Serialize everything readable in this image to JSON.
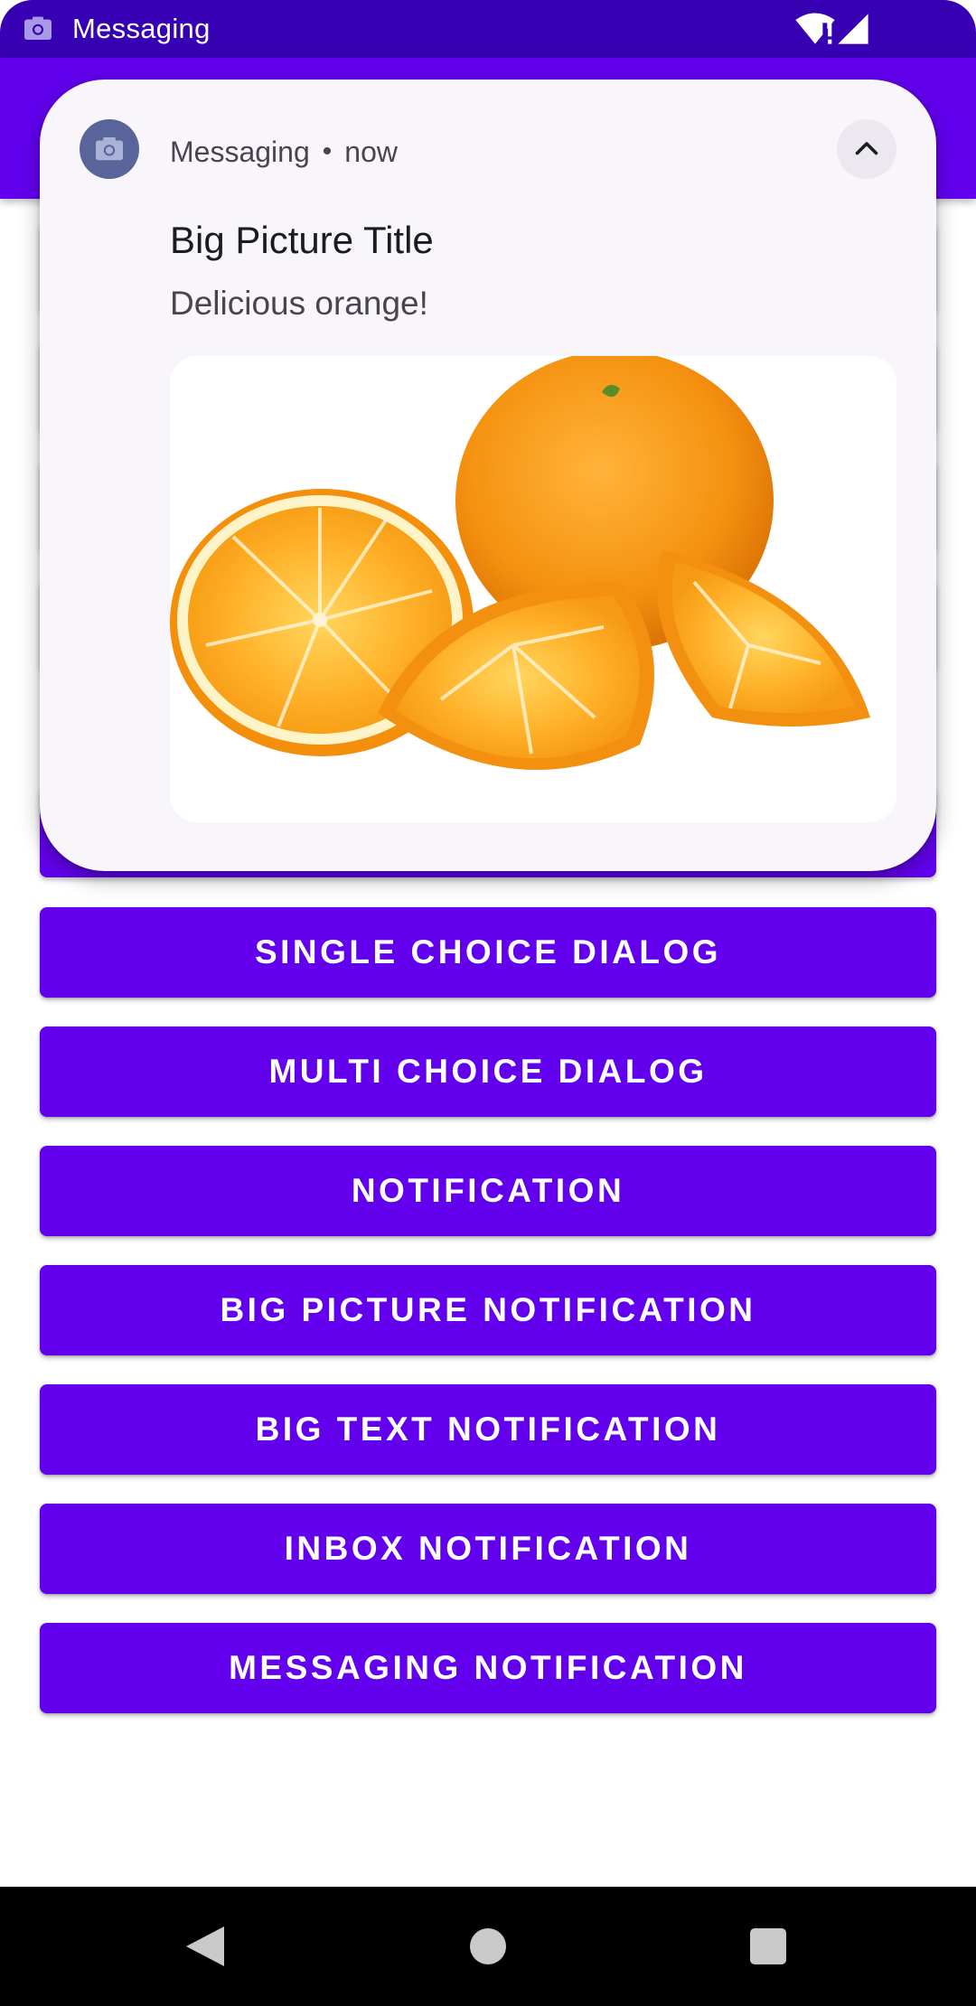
{
  "status_bar": {
    "title": "Messaging"
  },
  "notification": {
    "app_name": "Messaging",
    "time": "now",
    "separator": "•",
    "title": "Big Picture Title",
    "text": "Delicious orange!"
  },
  "buttons": [
    {
      "label": "SINGLE CHOICE DIALOG"
    },
    {
      "label": "MULTI CHOICE DIALOG"
    },
    {
      "label": "NOTIFICATION"
    },
    {
      "label": "BIG PICTURE NOTIFICATION"
    },
    {
      "label": "BIG TEXT NOTIFICATION"
    },
    {
      "label": "INBOX NOTIFICATION"
    },
    {
      "label": "MESSAGING NOTIFICATION"
    }
  ],
  "colors": {
    "primary": "#6200ee",
    "primary_dark": "#3700b3",
    "notification_bg": "#f8f6fb"
  }
}
